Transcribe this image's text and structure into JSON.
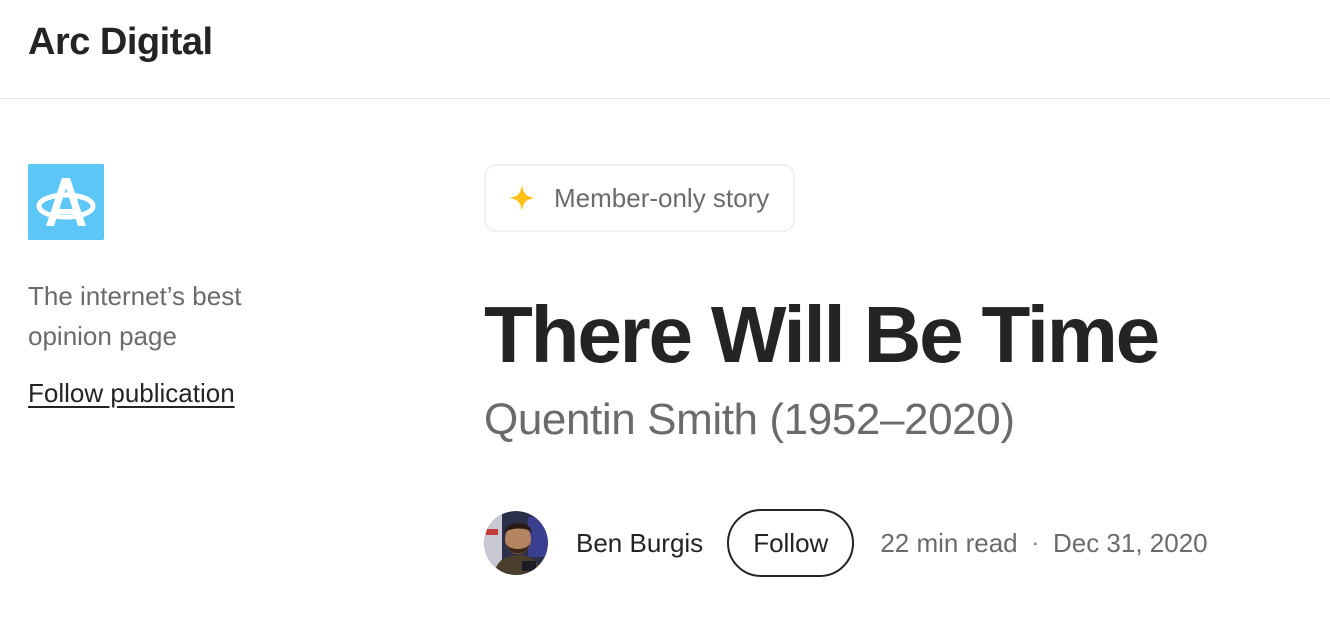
{
  "header": {
    "publication_title": "Arc Digital"
  },
  "sidebar": {
    "logo_icon": "arc-digital-logo-icon",
    "logo_color": "#5cc6f7",
    "description": "The internet’s best opinion page",
    "follow_publication_label": "Follow publication"
  },
  "article": {
    "badge": {
      "icon": "star-icon",
      "icon_color": "#ffc017",
      "label": "Member-only story"
    },
    "title": "There Will Be Time",
    "subtitle": "Quentin Smith (1952–2020)",
    "author": {
      "name": "Ben Burgis",
      "avatar_icon": "author-avatar"
    },
    "follow_label": "Follow",
    "read_time": "22 min read",
    "separator": "·",
    "date": "Dec 31, 2020"
  }
}
